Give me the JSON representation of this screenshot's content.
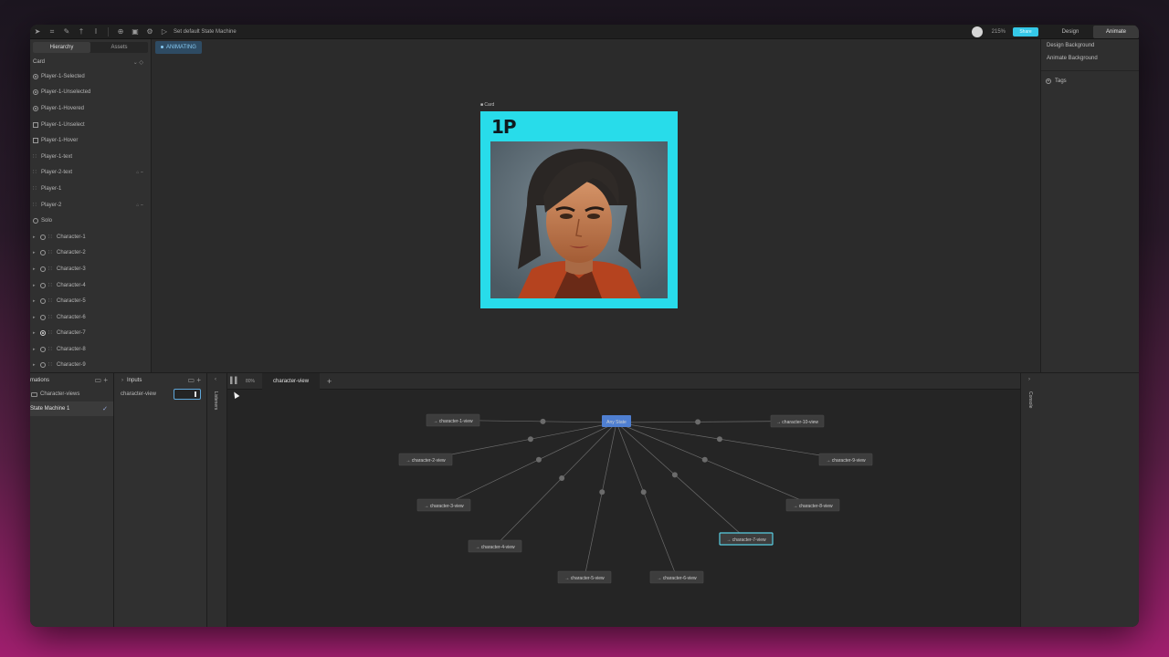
{
  "toolbar": {
    "state_machine_selector": "Set default State Machine",
    "zoom": "215%",
    "share_label": "Share",
    "mode_tabs": [
      {
        "label": "Design",
        "active": false
      },
      {
        "label": "Animate",
        "active": true
      }
    ],
    "icons": [
      "pointer-icon",
      "frame-icon",
      "pen-icon",
      "bone-icon",
      "text-icon",
      "plus-circle-icon",
      "component-icon",
      "settings-icon",
      "play-icon"
    ]
  },
  "left_panel": {
    "tabs": [
      {
        "label": "Hierarchy",
        "active": true
      },
      {
        "label": "Assets",
        "active": false
      }
    ],
    "root": "Card",
    "items": [
      {
        "label": "Player-1-Selected",
        "icon": "target"
      },
      {
        "label": "Player-1-Unselected",
        "icon": "target"
      },
      {
        "label": "Player-1-Hovered",
        "icon": "target"
      },
      {
        "label": "Player-1-Unselect",
        "icon": "square"
      },
      {
        "label": "Player-1-Hover",
        "icon": "square"
      },
      {
        "label": "Player-1-text",
        "icon": "grid"
      },
      {
        "label": "Player-2-text",
        "icon": "grid",
        "badges": true
      },
      {
        "label": "Player-1",
        "icon": "grid"
      },
      {
        "label": "Player-2",
        "icon": "grid",
        "badges": true
      },
      {
        "label": "Solo",
        "icon": "circle"
      }
    ],
    "characters": [
      {
        "label": "Character-1",
        "selected": false
      },
      {
        "label": "Character-2",
        "selected": false
      },
      {
        "label": "Character-3",
        "selected": false
      },
      {
        "label": "Character-4",
        "selected": false
      },
      {
        "label": "Character-5",
        "selected": false
      },
      {
        "label": "Character-6",
        "selected": false
      },
      {
        "label": "Character-7",
        "selected": true
      },
      {
        "label": "Character-8",
        "selected": false
      },
      {
        "label": "Character-9",
        "selected": false
      }
    ]
  },
  "stage": {
    "badge": "ANIMATING",
    "artboard_label": "Card",
    "card_title": "1P"
  },
  "right_panel": {
    "items": [
      "Design Background",
      "Animate Background"
    ],
    "tags_label": "Tags"
  },
  "bottom": {
    "animations_header": "mations",
    "animations": [
      {
        "label": "Character-views",
        "type": "folder",
        "active": false
      },
      {
        "label": "State Machine 1",
        "type": "state-machine",
        "active": true
      }
    ],
    "inputs_header": "Inputs",
    "input": {
      "label": "character-view",
      "value": ""
    },
    "listeners_label": "Listeners",
    "console_label": "Console",
    "graph_zoom": "80%",
    "graph_tab": "character-view",
    "state_machine": {
      "any_state": "Any State",
      "states": [
        {
          "label": "character-1-view",
          "selected": false
        },
        {
          "label": "character-2-view",
          "selected": false
        },
        {
          "label": "character-3-view",
          "selected": false
        },
        {
          "label": "character-4-view",
          "selected": false
        },
        {
          "label": "character-5-view",
          "selected": false
        },
        {
          "label": "character-6-view",
          "selected": false
        },
        {
          "label": "character-7-view",
          "selected": true
        },
        {
          "label": "character-8-view",
          "selected": false
        },
        {
          "label": "character-9-view",
          "selected": false
        },
        {
          "label": "character-10-view",
          "selected": false
        }
      ]
    }
  },
  "colors": {
    "accent": "#35c8e8",
    "card_background": "#28dcea",
    "animating_badge": "#2e4b63",
    "selected_node_border": "#58cfe3"
  }
}
